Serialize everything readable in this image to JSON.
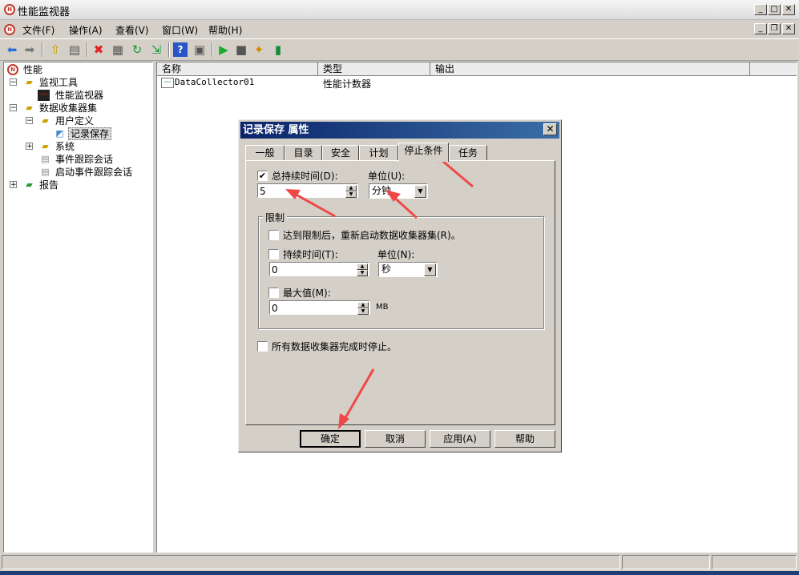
{
  "window": {
    "title": "性能监视器"
  },
  "menu": [
    "文件(F)",
    "操作(A)",
    "查看(V)",
    "窗口(W)",
    "帮助(H)"
  ],
  "tree": {
    "root": "性能",
    "monitoring_tools": "监视工具",
    "perf_monitor": "性能监视器",
    "dcs": "数据收集器集",
    "user_defined": "用户定义",
    "selected": "记录保存",
    "system": "系统",
    "event_trace": "事件跟踪会话",
    "startup_trace": "启动事件跟踪会话",
    "reports": "报告"
  },
  "list": {
    "columns": [
      "名称",
      "类型",
      "输出"
    ],
    "rows": [
      {
        "name": "DataCollector01",
        "type": "性能计数器",
        "output": ""
      }
    ]
  },
  "dialog": {
    "title": "记录保存 属性",
    "tabs": [
      "一般",
      "目录",
      "安全",
      "计划",
      "停止条件",
      "任务"
    ],
    "active_tab": "停止条件",
    "overall_duration_label": "总持续时间(D):",
    "overall_duration_checked": true,
    "overall_duration_value": "5",
    "unit_label": "单位(U):",
    "unit_value": "分钟",
    "limits_group": "限制",
    "restart_label": "达到限制后，重新启动数据收集器集(R)。",
    "duration_label": "持续时间(T):",
    "duration_value": "0",
    "unit2_label": "单位(N):",
    "unit2_value": "秒",
    "max_size_label": "最大值(M):",
    "max_size_value": "0",
    "max_size_unit": "MB",
    "stop_all_label": "所有数据收集器完成时停止。",
    "buttons": {
      "ok": "确定",
      "cancel": "取消",
      "apply": "应用(A)",
      "help": "帮助"
    }
  },
  "colors": {
    "arrow": "#f04848",
    "title_active": "#0a246a"
  }
}
